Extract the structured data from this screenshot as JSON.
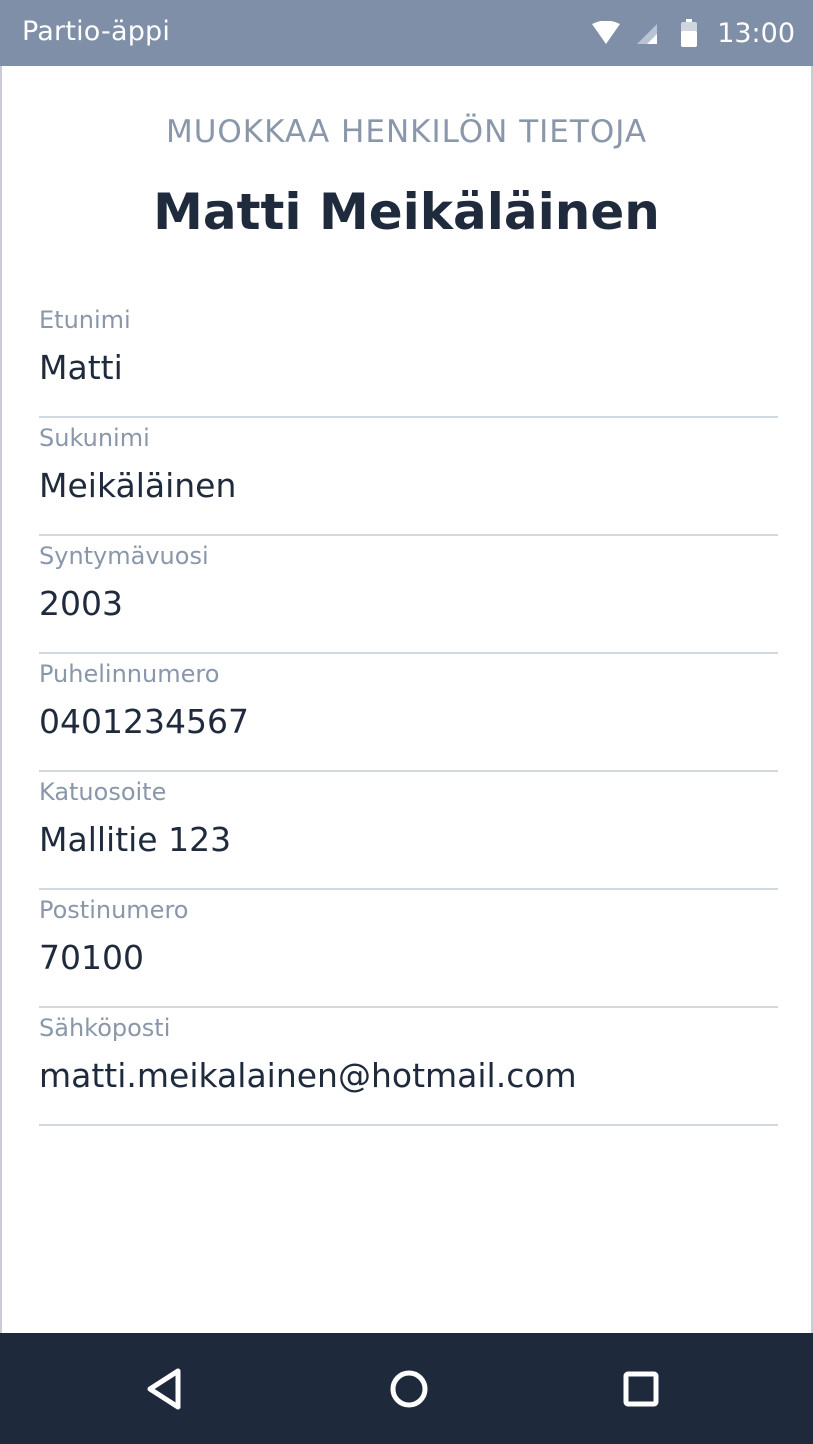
{
  "status_bar": {
    "app_name": "Partio-äppi",
    "time": "13:00",
    "icons": [
      "wifi-icon",
      "signal-icon",
      "battery-icon"
    ]
  },
  "header": {
    "subtitle": "MUOKKAA HENKILÖN TIETOJA",
    "title": "Matti Meikäläinen"
  },
  "form": {
    "fields": [
      {
        "label": "Etunimi",
        "value": "Matti"
      },
      {
        "label": "Sukunimi",
        "value": "Meikäläinen"
      },
      {
        "label": "Syntymävuosi",
        "value": "2003"
      },
      {
        "label": "Puhelinnumero",
        "value": "0401234567"
      },
      {
        "label": "Katuosoite",
        "value": "Mallitie 123"
      },
      {
        "label": "Postinumero",
        "value": "70100"
      },
      {
        "label": "Sähköposti",
        "value": "matti.meikalainen@hotmail.com"
      }
    ]
  },
  "nav_bar": {
    "buttons": [
      "back-icon",
      "home-icon",
      "recent-apps-icon"
    ]
  },
  "colors": {
    "status_bar": "#7f8fa8",
    "nav_bar": "#1e2a3c",
    "text_dark": "#1f2b3d",
    "text_muted": "#8a97ab",
    "divider": "#d2d8e0"
  }
}
